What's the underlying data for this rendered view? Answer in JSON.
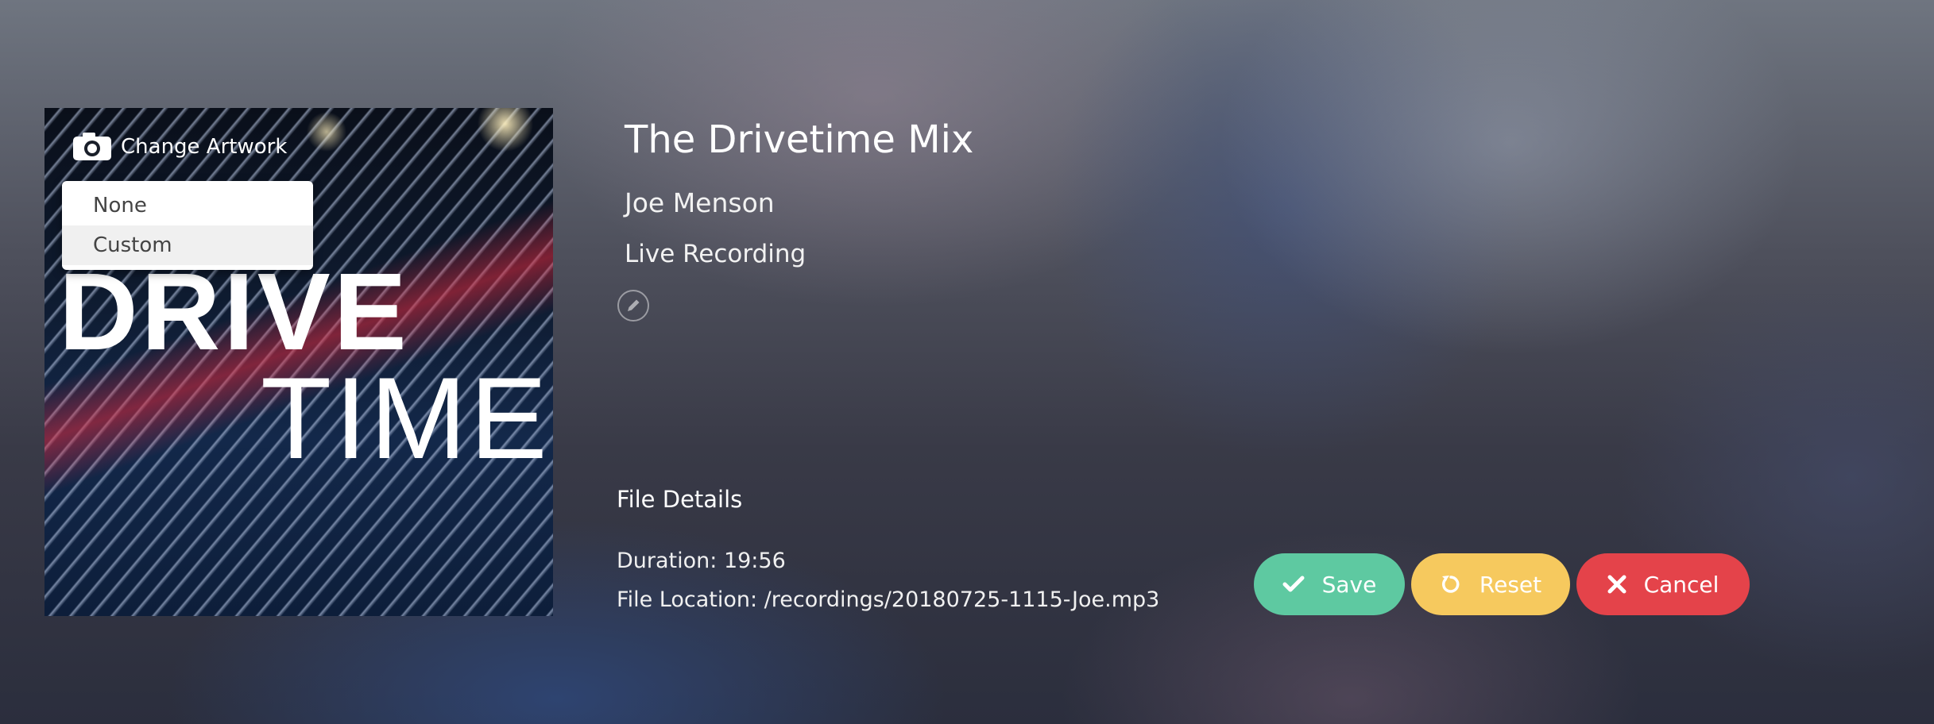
{
  "artwork": {
    "change_label": "Change Artwork",
    "camera_icon": "camera-icon",
    "art_text_line1": "DRIVE",
    "art_text_line2": "TIME",
    "dropdown": {
      "options": [
        "None",
        "Custom"
      ],
      "highlighted": "Custom"
    }
  },
  "track": {
    "title": "The Drivetime Mix",
    "artist": "Joe Menson",
    "album": "Live Recording",
    "edit_icon": "pencil-icon"
  },
  "file_details": {
    "heading": "File Details",
    "duration": "Duration: 19:56",
    "location": "File Location: /recordings/20180725-1115-Joe.mp3"
  },
  "actions": {
    "save_label": "Save",
    "reset_label": "Reset",
    "cancel_label": "Cancel",
    "save_color": "#5ec9a1",
    "reset_color": "#f6c95e",
    "cancel_color": "#e4434a"
  }
}
